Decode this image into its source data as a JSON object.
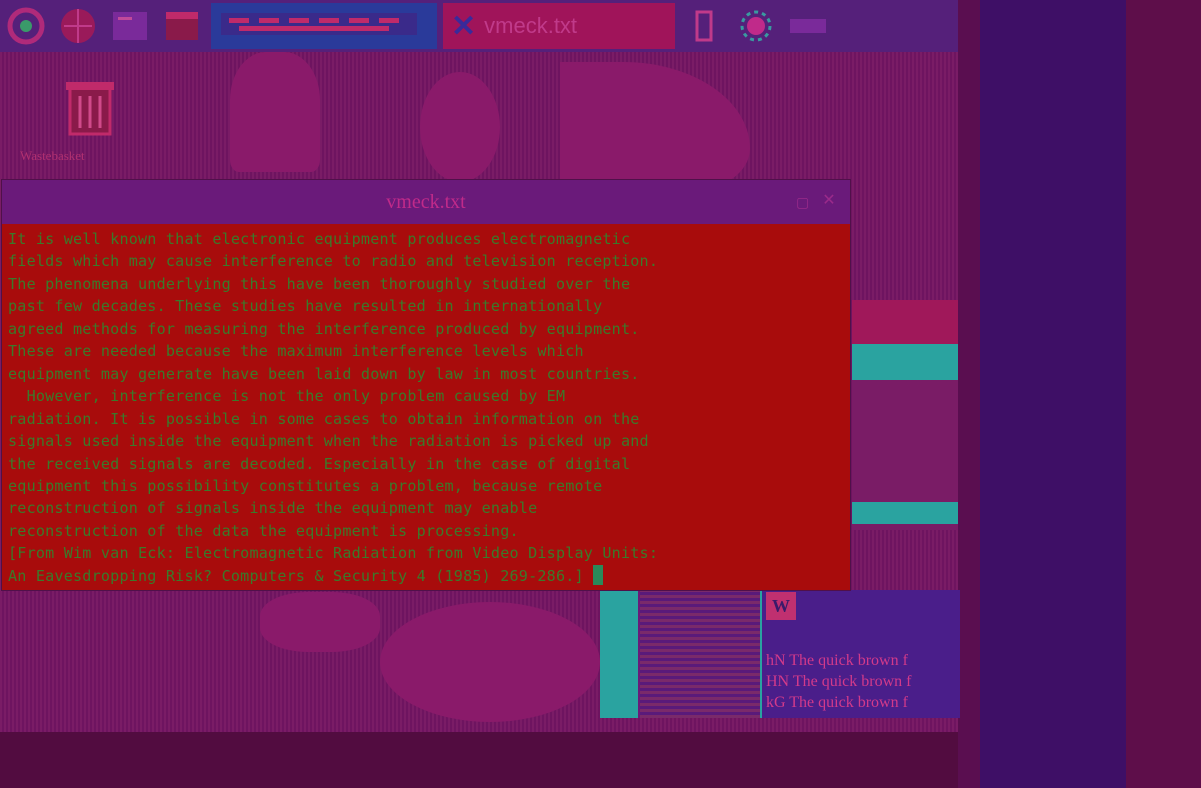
{
  "taskbar": {
    "icons": [
      "debian-swirl-icon",
      "globe-icon",
      "terminal-icon",
      "calendar-icon"
    ],
    "tasks": [
      {
        "label": "",
        "icon": "keyboard-icon"
      },
      {
        "label": "vmeck.txt",
        "icon": "x-icon"
      }
    ],
    "tray_icons": [
      "bookmark-icon",
      "gear-icon",
      "clock-icon"
    ]
  },
  "desktop": {
    "trash_label": "Wastebasket"
  },
  "terminal": {
    "title": "vmeck.txt",
    "lines": [
      "It is well known that electronic equipment produces electromagnetic",
      "fields which may cause interference to radio and television reception.",
      "The phenomena underlying this have been thoroughly studied over the",
      "past few decades. These studies have resulted in internationally",
      "agreed methods for measuring the interference produced by equipment.",
      "These are needed because the maximum interference levels which",
      "equipment may generate have been laid down by law in most countries.",
      "  However, interference is not the only problem caused by EM",
      "radiation. It is possible in some cases to obtain information on the",
      "signals used inside the equipment when the radiation is picked up and",
      "the received signals are decoded. Especially in the case of digital",
      "equipment this possibility constitutes a problem, because remote",
      "reconstruction of signals inside the equipment may enable",
      "reconstruction of the data the equipment is processing.",
      "[From Wim van Eck: Electromagnetic Radiation from Video Display Units:",
      "An Eavesdropping Risk? Computers & Security 4 (1985) 269-286.] "
    ]
  },
  "font_viewer": {
    "tag": "W",
    "lines": [
      "hN The quick brown f",
      "HN The quick brown f",
      "kG The quick brown f"
    ]
  },
  "colors": {
    "terminal_bg": "#a80c0c",
    "terminal_text": "#3a7a2a",
    "taskbar_bg": "#55207a",
    "accent_teal": "#2aa3a0"
  }
}
